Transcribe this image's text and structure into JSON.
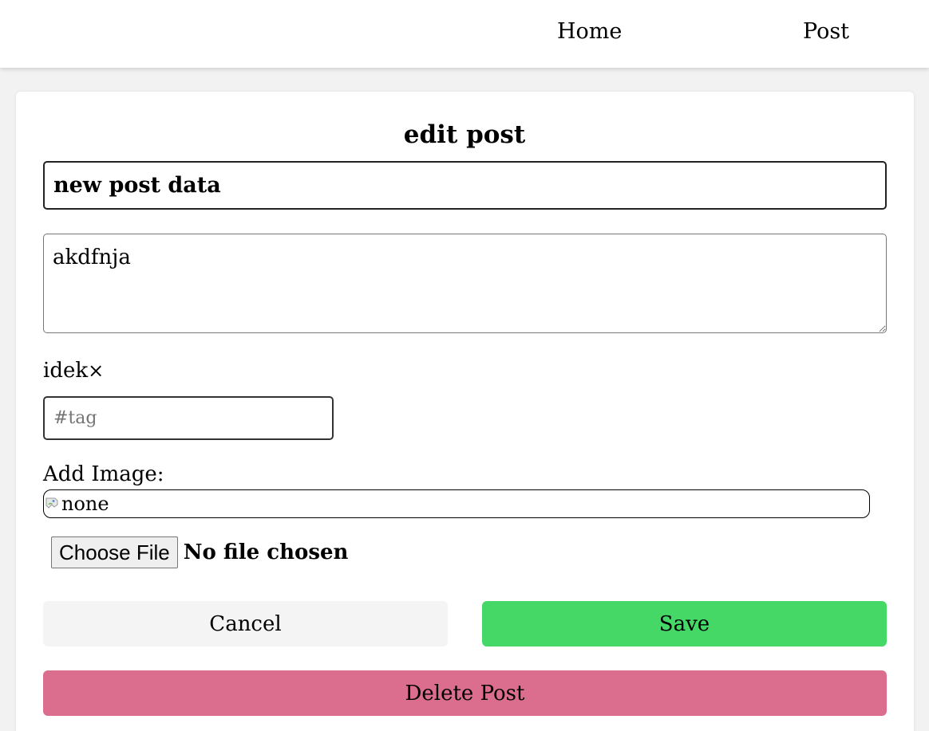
{
  "nav": {
    "home_label": "Home",
    "post_label": "Post"
  },
  "form": {
    "heading": "edit post",
    "title_value": "new post data",
    "body_value": "akdfnja",
    "tags": [
      {
        "label": "idek",
        "remove_symbol": "×"
      }
    ],
    "tag_placeholder": "#tag",
    "add_image_label": "Add Image:",
    "image_alt_text": "none",
    "choose_file_label": "Choose File",
    "file_status": "No file chosen"
  },
  "actions": {
    "cancel_label": "Cancel",
    "save_label": "Save",
    "delete_label": "Delete Post"
  },
  "colors": {
    "save": "#45d866",
    "delete": "#db6e8e",
    "cancel": "#f4f4f4"
  }
}
